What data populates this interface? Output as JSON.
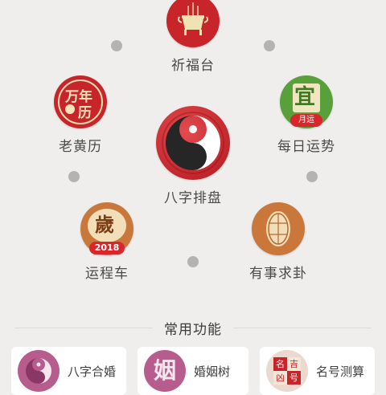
{
  "hub": {
    "center": {
      "label": "八字排盘"
    },
    "items": [
      {
        "label": "祈福台"
      },
      {
        "label": "老黄历",
        "glyph_main": "万年",
        "glyph_sub": "历"
      },
      {
        "label": "每日运势",
        "glyph": "宜",
        "badge": "月运"
      },
      {
        "label": "运程车",
        "glyph": "歲",
        "badge": "2018"
      },
      {
        "label": "有事求卦"
      }
    ]
  },
  "common": {
    "title": "常用功能",
    "cards": [
      {
        "label": "八字合婚"
      },
      {
        "label": "婚姻树",
        "glyph": "姻"
      },
      {
        "label": "名号测算",
        "glyphs": [
          "名",
          "吉",
          "凶",
          "号"
        ]
      }
    ]
  },
  "colors": {
    "background": "#efeeec",
    "red": "#c8252b",
    "green": "#58a03a",
    "orange": "#c9773a",
    "dot": "#b3b3b3"
  }
}
